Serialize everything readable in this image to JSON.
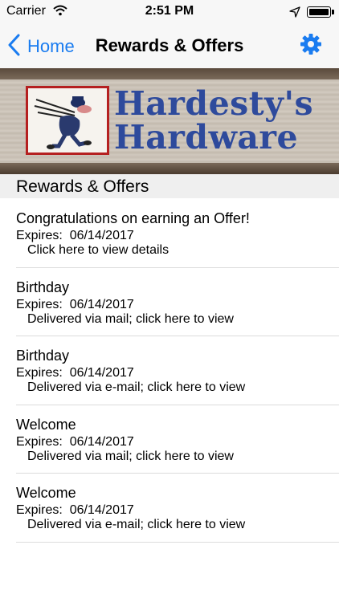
{
  "status_bar": {
    "carrier": "Carrier",
    "time": "2:51 PM",
    "icons": [
      "wifi-icon",
      "location-arrow-icon",
      "battery-icon"
    ]
  },
  "nav": {
    "back_label": "Home",
    "title": "Rewards & Offers",
    "settings_icon": "gear-icon",
    "accent_color": "#1a7cf0"
  },
  "banner": {
    "brand_line1": "Hardesty's",
    "brand_line2": "Hardware",
    "brand_color": "#2e4a9c"
  },
  "section": {
    "title": "Rewards & Offers"
  },
  "offers": [
    {
      "title": "Congratulations on earning an Offer!",
      "expires": "Expires:  06/14/2017",
      "detail": "Click here to view details"
    },
    {
      "title": "Birthday",
      "expires": "Expires:  06/14/2017",
      "detail": "Delivered via mail; click here to view"
    },
    {
      "title": "Birthday",
      "expires": "Expires:  06/14/2017",
      "detail": "Delivered via e-mail; click here to view"
    },
    {
      "title": "Welcome",
      "expires": "Expires:  06/14/2017",
      "detail": "Delivered via mail; click here to view"
    },
    {
      "title": "Welcome",
      "expires": "Expires:  06/14/2017",
      "detail": "Delivered via e-mail; click here to view"
    }
  ]
}
